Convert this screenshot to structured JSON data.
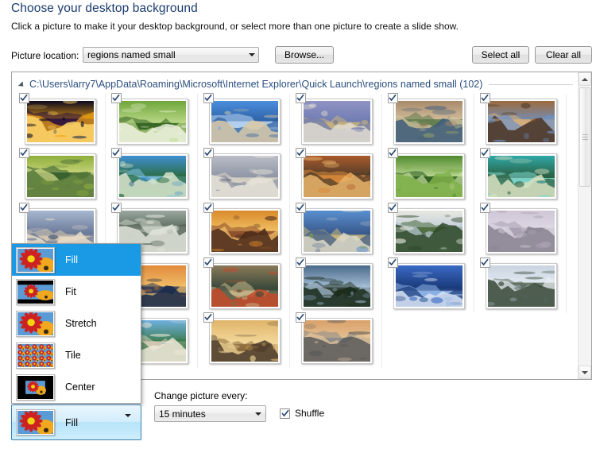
{
  "header": {
    "title": "Choose your desktop background",
    "subtitle": "Click a picture to make it your desktop background, or select more than one picture to create a slide show."
  },
  "toolbar": {
    "location_label": "Picture location:",
    "location_value": "regions named small",
    "browse_label": "Browse...",
    "select_all_label": "Select all",
    "clear_all_label": "Clear all"
  },
  "list": {
    "group_title": "C:\\Users\\larry7\\AppData\\Roaming\\Microsoft\\Internet Explorer\\Quick Launch\\regions named small (102)",
    "thumbnails": [
      {
        "name": "fireworks-harbor",
        "checked": true
      },
      {
        "name": "rainforest-stream",
        "checked": true
      },
      {
        "name": "sydney-harbour",
        "checked": true
      },
      {
        "name": "twelve-apostles-coast",
        "checked": true
      },
      {
        "name": "rocky-river-gorge",
        "checked": true
      },
      {
        "name": "baobab-avenue",
        "checked": true
      },
      {
        "name": "lily-pads-lagoon",
        "checked": true
      },
      {
        "name": "tropical-rainbow-bay",
        "checked": true
      },
      {
        "name": "sand-dune-tidal-flat",
        "checked": true
      },
      {
        "name": "canyon-sunrise-cliffs",
        "checked": true
      },
      {
        "name": "jungle-waterfall-pool",
        "checked": true
      },
      {
        "name": "turquoise-island-cove",
        "checked": true
      },
      {
        "name": "city-river-skyline",
        "checked": true
      },
      {
        "name": "misty-lake-boat",
        "checked": true
      },
      {
        "name": "golden-rocks-sunset",
        "checked": true
      },
      {
        "name": "sea-stack-headland",
        "checked": true
      },
      {
        "name": "white-chalk-cliffs",
        "checked": true
      },
      {
        "name": "stonehenge-dusk",
        "checked": true
      },
      {
        "name": "pastel-shore-dawn",
        "checked": true
      },
      {
        "name": "orange-lake-sunset",
        "checked": true
      },
      {
        "name": "red-canoe-lakeshore",
        "checked": true
      },
      {
        "name": "mountain-lake-island",
        "checked": true
      },
      {
        "name": "alpine-blue-peaks",
        "checked": true
      },
      {
        "name": "snow-forest-ridge",
        "checked": true
      },
      {
        "name": "misty-terraced-hills",
        "checked": true
      },
      {
        "name": "beach-boulders-sky",
        "checked": true
      },
      {
        "name": "bridge-arches-golden",
        "checked": true
      },
      {
        "name": "karst-river-fisherman",
        "checked": true
      }
    ],
    "scrollbar": {
      "up_arrow": "scroll-up-icon",
      "down_arrow": "scroll-down-icon"
    }
  },
  "position_menu": {
    "open": true,
    "selected": "Fill",
    "items": [
      {
        "label": "Fill",
        "icon": "fill-preview-icon",
        "selected": true
      },
      {
        "label": "Fit",
        "icon": "fit-preview-icon",
        "selected": false
      },
      {
        "label": "Stretch",
        "icon": "stretch-preview-icon",
        "selected": false
      },
      {
        "label": "Tile",
        "icon": "tile-preview-icon",
        "selected": false
      },
      {
        "label": "Center",
        "icon": "center-preview-icon",
        "selected": false
      }
    ],
    "combo_value": "Fill"
  },
  "bottom": {
    "change_label": "Change picture every:",
    "interval_value": "15 minutes",
    "shuffle_label": "Shuffle",
    "shuffle_checked": true
  },
  "colors": {
    "title_blue": "#1b3b6f",
    "group_blue": "#2b4e7e",
    "highlight_blue": "#1a9ae5",
    "combo_border_blue": "#3c7fb1"
  }
}
